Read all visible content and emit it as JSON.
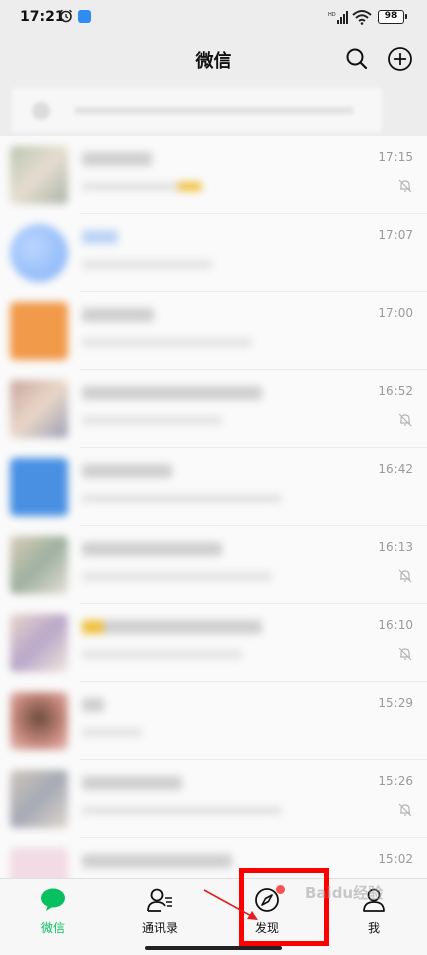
{
  "status_bar": {
    "time": "17:21",
    "battery": "98",
    "icons": [
      "alarm-icon",
      "app-notification-icon",
      "signal-icon",
      "wifi-icon",
      "battery-icon"
    ]
  },
  "header": {
    "title": "微信",
    "icons": [
      "search-icon",
      "add-icon"
    ]
  },
  "chats": [
    {
      "time": "17:15",
      "muted": true
    },
    {
      "time": "17:07",
      "muted": false
    },
    {
      "time": "17:00",
      "muted": false
    },
    {
      "time": "16:52",
      "muted": true
    },
    {
      "time": "16:42",
      "muted": false
    },
    {
      "time": "16:13",
      "muted": true
    },
    {
      "time": "16:10",
      "muted": true
    },
    {
      "time": "15:29",
      "muted": false
    },
    {
      "time": "15:26",
      "muted": true
    },
    {
      "time": "15:02",
      "muted": false
    }
  ],
  "tabs": [
    {
      "label": "微信",
      "icon": "chat-bubble-icon",
      "active": true
    },
    {
      "label": "通讯录",
      "icon": "contacts-icon",
      "active": false
    },
    {
      "label": "发现",
      "icon": "compass-icon",
      "active": false,
      "badge": true
    },
    {
      "label": "我",
      "icon": "person-icon",
      "active": false
    }
  ],
  "colors": {
    "accent": "#07c160",
    "badge": "#fa5151",
    "highlight": "#ff0000",
    "background": "#ededed"
  },
  "watermark": "Baidu经验"
}
